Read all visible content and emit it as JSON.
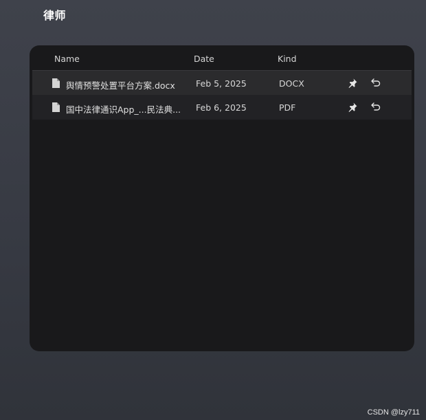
{
  "header": {
    "title": "律师"
  },
  "table": {
    "columns": {
      "name": "Name",
      "date": "Date",
      "kind": "Kind"
    },
    "rows": [
      {
        "name": "舆情预警处置平台方案.docx",
        "date": "Feb 5, 2025",
        "kind": "DOCX",
        "icons": [
          "file-icon",
          "pin-icon",
          "restore-icon"
        ]
      },
      {
        "name": "国中法律通识App_...民法典...",
        "date": "Feb 6, 2025",
        "kind": "PDF",
        "icons": [
          "file-icon",
          "pin-icon",
          "restore-icon"
        ]
      }
    ]
  },
  "watermark": "CSDN @lzy711",
  "colors": {
    "panel": "#19191b",
    "row_highlight": "#2b2b2d",
    "row": "#222225",
    "text": "#d8d8d8"
  }
}
